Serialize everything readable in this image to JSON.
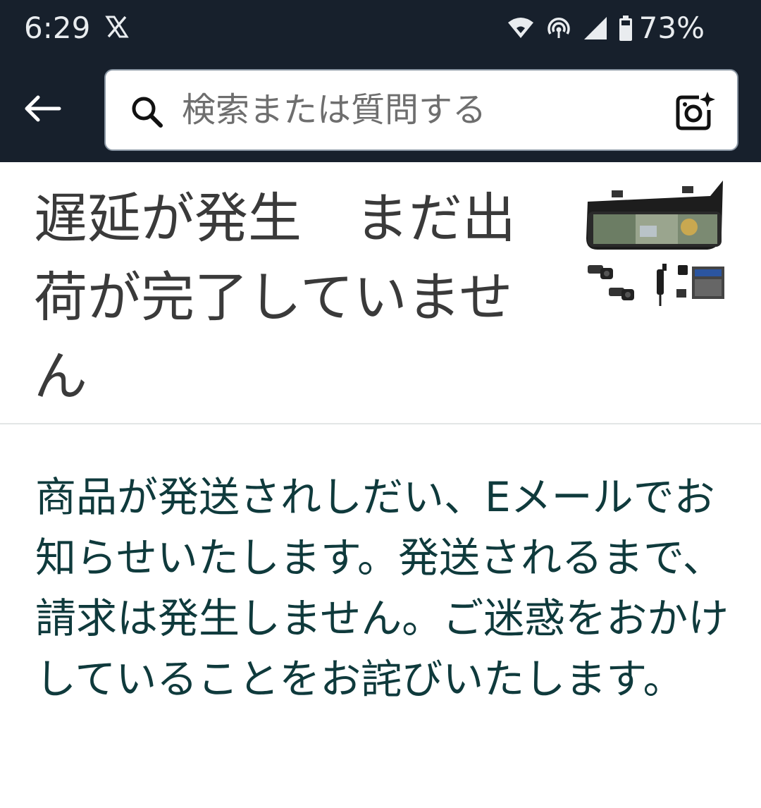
{
  "status_bar": {
    "time": "6:29",
    "notification_icon": "x-logo-icon",
    "battery_percent": "73%",
    "icons": [
      "wifi-icon",
      "hotspot-icon",
      "cell-signal-icon",
      "battery-icon"
    ]
  },
  "header": {
    "back_icon": "back-arrow-icon",
    "search": {
      "placeholder": "検索または質問する",
      "search_icon": "search-icon",
      "camera_icon": "camera-sparkle-icon"
    }
  },
  "order_status": {
    "title": "遅延が発生　まだ出荷が完了していません",
    "product_image": "dash-cam-mirror-product-image"
  },
  "message": {
    "text": "商品が発送されしだい、Eメールでお知らせいたします。発送されるまで、請求は発生しません。ご迷惑をおかけしていることをお詫びいたします。"
  },
  "colors": {
    "header_bg": "#17202c",
    "title_text": "#3a3a3a",
    "message_text": "#0f3a3c",
    "divider": "#e3e6e6"
  }
}
